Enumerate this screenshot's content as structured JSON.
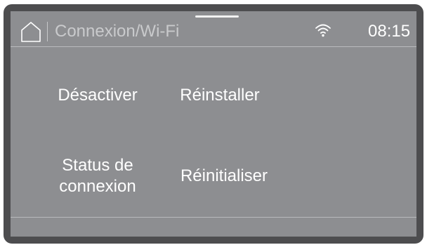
{
  "header": {
    "title": "Connexion/Wi-Fi",
    "time": "08:15",
    "home_icon": "home-icon",
    "wifi_icon": "wifi-icon"
  },
  "menu": {
    "disable": "Désactiver",
    "reinstall": "Réinstaller",
    "status": "Status de connexion",
    "reset": "Réinitialiser"
  },
  "colors": {
    "bezel": "#4d4d4f",
    "screen": "#8d8e91",
    "text": "#ffffff",
    "title_text": "#c9cacc",
    "divider": "#b9babd"
  }
}
